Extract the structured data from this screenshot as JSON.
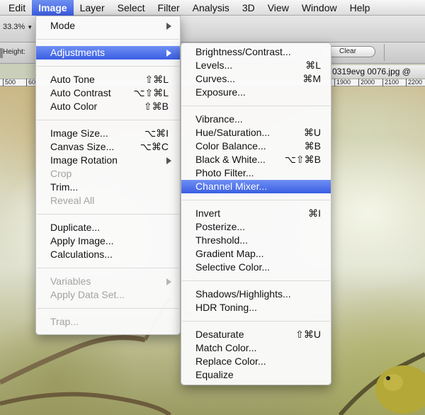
{
  "menubar": {
    "items": [
      {
        "label": "Edit"
      },
      {
        "label": "Image",
        "active": true
      },
      {
        "label": "Layer"
      },
      {
        "label": "Select"
      },
      {
        "label": "Filter"
      },
      {
        "label": "Analysis"
      },
      {
        "label": "3D"
      },
      {
        "label": "View"
      },
      {
        "label": "Window"
      },
      {
        "label": "Help"
      }
    ]
  },
  "options": {
    "zoom": "33.3%",
    "height_label": "Height:",
    "clear_button": "Clear"
  },
  "document": {
    "tab_title": "0319evg 0076.jpg @",
    "ruler_labels": [
      "500",
      "60",
      "1900",
      "2000",
      "2100",
      "2200"
    ]
  },
  "image_menu": {
    "items": [
      {
        "label": "Mode",
        "submenu": true
      },
      {
        "separator": true
      },
      {
        "label": "Adjustments",
        "submenu": true,
        "highlighted": true
      },
      {
        "separator": true
      },
      {
        "label": "Auto Tone",
        "shortcut": "⇧⌘L"
      },
      {
        "label": "Auto Contrast",
        "shortcut": "⌥⇧⌘L"
      },
      {
        "label": "Auto Color",
        "shortcut": "⇧⌘B"
      },
      {
        "separator": true
      },
      {
        "label": "Image Size...",
        "shortcut": "⌥⌘I"
      },
      {
        "label": "Canvas Size...",
        "shortcut": "⌥⌘C"
      },
      {
        "label": "Image Rotation",
        "submenu": true
      },
      {
        "label": "Crop",
        "disabled": true
      },
      {
        "label": "Trim..."
      },
      {
        "label": "Reveal All",
        "disabled": true
      },
      {
        "separator": true
      },
      {
        "label": "Duplicate..."
      },
      {
        "label": "Apply Image..."
      },
      {
        "label": "Calculations..."
      },
      {
        "separator": true
      },
      {
        "label": "Variables",
        "submenu": true,
        "disabled": true
      },
      {
        "label": "Apply Data Set...",
        "disabled": true
      },
      {
        "separator": true
      },
      {
        "label": "Trap...",
        "disabled": true
      }
    ]
  },
  "adjustments_menu": {
    "items": [
      {
        "label": "Brightness/Contrast..."
      },
      {
        "label": "Levels...",
        "shortcut": "⌘L"
      },
      {
        "label": "Curves...",
        "shortcut": "⌘M"
      },
      {
        "label": "Exposure..."
      },
      {
        "separator": true
      },
      {
        "label": "Vibrance..."
      },
      {
        "label": "Hue/Saturation...",
        "shortcut": "⌘U"
      },
      {
        "label": "Color Balance...",
        "shortcut": "⌘B"
      },
      {
        "label": "Black & White...",
        "shortcut": "⌥⇧⌘B"
      },
      {
        "label": "Photo Filter..."
      },
      {
        "label": "Channel Mixer...",
        "highlighted": true
      },
      {
        "separator": true
      },
      {
        "label": "Invert",
        "shortcut": "⌘I"
      },
      {
        "label": "Posterize..."
      },
      {
        "label": "Threshold..."
      },
      {
        "label": "Gradient Map..."
      },
      {
        "label": "Selective Color..."
      },
      {
        "separator": true
      },
      {
        "label": "Shadows/Highlights..."
      },
      {
        "label": "HDR Toning..."
      },
      {
        "separator": true
      },
      {
        "label": "Desaturate",
        "shortcut": "⇧⌘U"
      },
      {
        "label": "Match Color..."
      },
      {
        "label": "Replace Color..."
      },
      {
        "label": "Equalize"
      }
    ]
  },
  "colors": {
    "highlight": "#3a5ee3",
    "disabled_text": "#a3a3a3"
  }
}
